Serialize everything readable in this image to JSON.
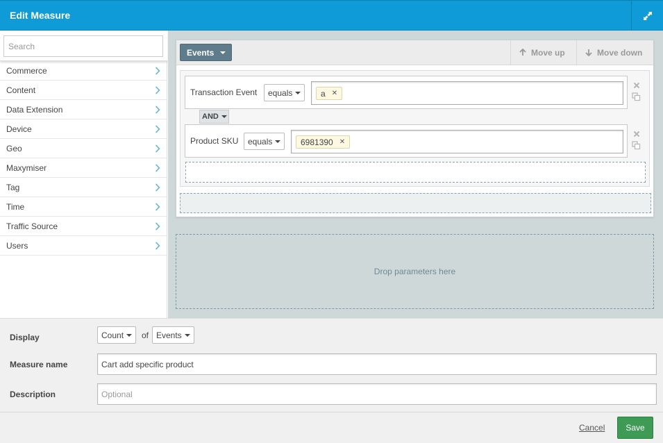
{
  "window": {
    "title": "Edit Measure",
    "expand_icon": "expand-arrows-icon"
  },
  "sidebar": {
    "search_placeholder": "Search",
    "items": [
      {
        "label": "Commerce"
      },
      {
        "label": "Content"
      },
      {
        "label": "Data Extension"
      },
      {
        "label": "Device"
      },
      {
        "label": "Geo"
      },
      {
        "label": "Maxymiser"
      },
      {
        "label": "Tag"
      },
      {
        "label": "Time"
      },
      {
        "label": "Traffic Source"
      },
      {
        "label": "Users"
      }
    ]
  },
  "builder": {
    "scope_label": "Events",
    "move_up_label": "Move up",
    "move_down_label": "Move down",
    "conditions": [
      {
        "field": "Transaction Event",
        "operator": "equals",
        "values": [
          "a"
        ]
      },
      {
        "field": "Product SKU",
        "operator": "equals",
        "values": [
          "6981390"
        ]
      }
    ],
    "connector": "AND",
    "drop_text": "Drop parameters here"
  },
  "form": {
    "display_label": "Display",
    "display_function": "Count",
    "of_label": "of",
    "display_scope": "Events",
    "name_label": "Measure name",
    "name_value": "Cart add specific product",
    "description_label": "Description",
    "description_placeholder": "Optional"
  },
  "footer": {
    "cancel_label": "Cancel",
    "save_label": "Save"
  },
  "colors": {
    "header": "#0f9bd7",
    "save": "#3f9a55",
    "events_button": "#5e7c8b",
    "workspace": "#cfd8d9"
  }
}
